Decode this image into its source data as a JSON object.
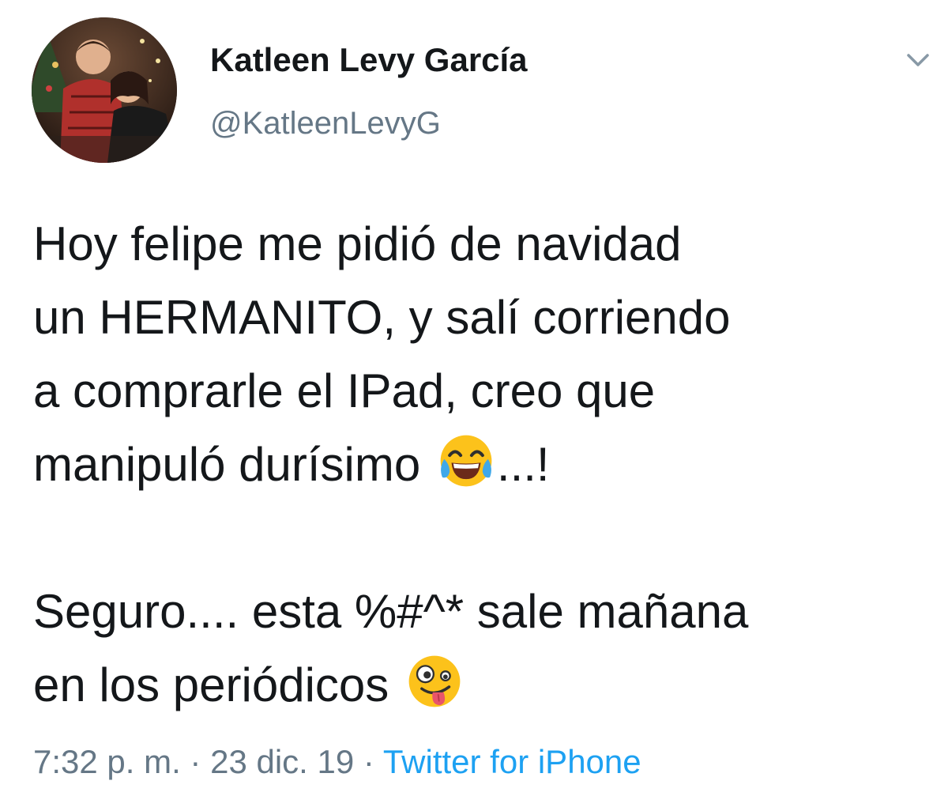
{
  "author": {
    "name": "Katleen Levy García",
    "handle": "@KatleenLevyG"
  },
  "tweet": {
    "lines": [
      "Hoy felipe me pidió de navidad",
      "un HERMANITO, y salí corriendo",
      "a comprarle el IPad, creo que"
    ],
    "line4_text": "manipuló durísimo ",
    "line4_suffix": "...!",
    "line5": "Seguro.... esta %#^* sale mañana",
    "line6_text": "en los periódicos "
  },
  "meta": {
    "time": "7:32 p. m.",
    "separator": " · ",
    "date": "23 dic. 19",
    "source": "Twitter for iPhone"
  },
  "icons": {
    "more_options": "chevron-down-icon",
    "emoji_1": "face-with-tears-of-joy-icon",
    "emoji_2": "zany-face-icon"
  },
  "colors": {
    "text": "#14171a",
    "secondary": "#657786",
    "link": "#1da1f2"
  }
}
